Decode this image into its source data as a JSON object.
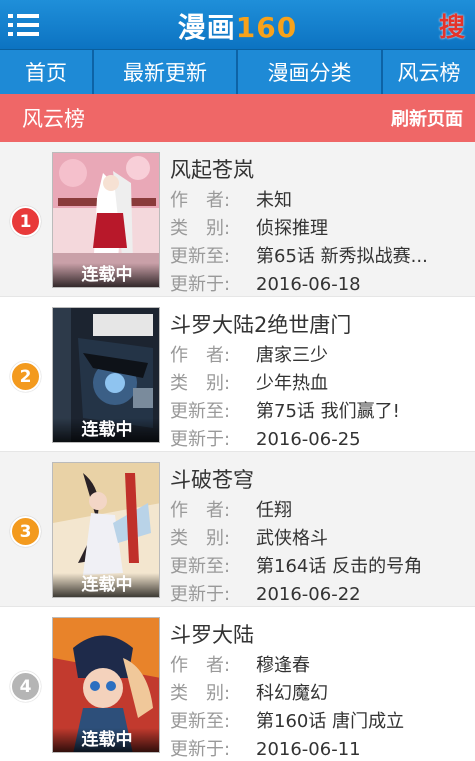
{
  "header": {
    "logo_cn": "漫画",
    "logo_num": "160",
    "search_glyph": "搜",
    "menu_icon": "menu-icon"
  },
  "nav": {
    "items": [
      {
        "label": "首页"
      },
      {
        "label": "最新更新"
      },
      {
        "label": "漫画分类"
      },
      {
        "label": "风云榜"
      }
    ]
  },
  "section": {
    "title": "风云榜",
    "refresh_label": "刷新页面"
  },
  "labels": {
    "author": "作　者:",
    "category": "类　别:",
    "updated_to": "更新至:",
    "updated_on": "更新于:"
  },
  "colors": {
    "header_blue": "#0c73c2",
    "section_red": "#ef6767",
    "logo_orange": "#f7a21b",
    "rank1": "#e83a3a",
    "rank2": "#f39a1e",
    "rank3": "#f39a1e",
    "rank4": "#b5b5b5"
  },
  "list": [
    {
      "rank": "1",
      "title": "风起苍岚",
      "author": "未知",
      "category": "侦探推理",
      "latest": "第65话 新秀拟战赛...",
      "date": "2016-06-18",
      "status": "连载中"
    },
    {
      "rank": "2",
      "title": "斗罗大陆2绝世唐门",
      "author": "唐家三少",
      "category": "少年热血",
      "latest": "第75话 我们赢了!",
      "date": "2016-06-25",
      "status": "连载中"
    },
    {
      "rank": "3",
      "title": "斗破苍穹",
      "author": "任翔",
      "category": "武侠格斗",
      "latest": "第164话 反击的号角",
      "date": "2016-06-22",
      "status": "连载中"
    },
    {
      "rank": "4",
      "title": "斗罗大陆",
      "author": "穆逢春",
      "category": "科幻魔幻",
      "latest": "第160话 唐门成立",
      "date": "2016-06-11",
      "status": "连载中"
    }
  ]
}
